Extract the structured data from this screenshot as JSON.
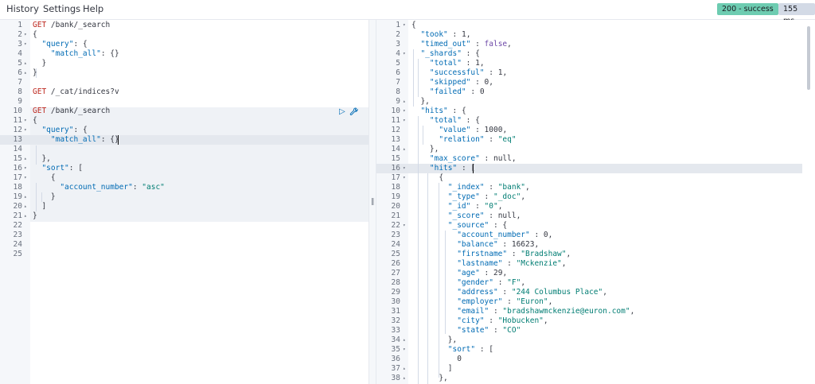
{
  "menu": {
    "history": "History",
    "settings": "Settings",
    "help": "Help"
  },
  "status": {
    "code": "200 - success",
    "time": "155 ms",
    "success_color": "#6dccb1"
  },
  "icons": {
    "play": "play-icon",
    "wrench": "wrench-icon",
    "resize": "resize-handle-icon",
    "fold_down": "fold-down-icon",
    "fold_up": "fold-up-icon"
  },
  "request_editor": {
    "lines": [
      {
        "n": "1",
        "fold": "",
        "t": [
          [
            "method",
            "GET"
          ],
          [
            "url",
            " /bank/_search"
          ]
        ]
      },
      {
        "n": "2",
        "fold": "▾",
        "t": [
          [
            "punc",
            "{"
          ]
        ]
      },
      {
        "n": "3",
        "fold": "▾",
        "t": [
          [
            "punc",
            "  "
          ],
          [
            "key",
            "\"query\""
          ],
          [
            "punc",
            ": {"
          ]
        ]
      },
      {
        "n": "4",
        "fold": "",
        "t": [
          [
            "punc",
            "    "
          ],
          [
            "key",
            "\"match_all\""
          ],
          [
            "punc",
            ": {}"
          ]
        ]
      },
      {
        "n": "5",
        "fold": "▴",
        "t": [
          [
            "punc",
            "  }"
          ]
        ]
      },
      {
        "n": "6",
        "fold": "▴",
        "t": [
          [
            "punc",
            "}"
          ]
        ]
      },
      {
        "n": "7",
        "fold": "",
        "t": []
      },
      {
        "n": "8",
        "fold": "",
        "t": [
          [
            "method",
            "GET"
          ],
          [
            "url",
            " /_cat/indices?v"
          ]
        ]
      },
      {
        "n": "9",
        "fold": "",
        "t": []
      },
      {
        "n": "10",
        "fold": "",
        "t": [
          [
            "method",
            "GET"
          ],
          [
            "url",
            " /bank/_search"
          ]
        ]
      },
      {
        "n": "11",
        "fold": "▾",
        "t": [
          [
            "punc",
            "{"
          ]
        ]
      },
      {
        "n": "12",
        "fold": "▾",
        "t": [
          [
            "punc",
            "  "
          ],
          [
            "key",
            "\"query\""
          ],
          [
            "punc",
            ": {"
          ]
        ]
      },
      {
        "n": "13",
        "fold": "",
        "t": [
          [
            "punc",
            "    "
          ],
          [
            "key",
            "\"match_all\""
          ],
          [
            "punc",
            ": {}"
          ]
        ]
      },
      {
        "n": "14",
        "fold": "",
        "t": []
      },
      {
        "n": "15",
        "fold": "▴",
        "t": [
          [
            "punc",
            "  },"
          ]
        ]
      },
      {
        "n": "16",
        "fold": "▾",
        "t": [
          [
            "punc",
            "  "
          ],
          [
            "key",
            "\"sort\""
          ],
          [
            "punc",
            ": ["
          ]
        ]
      },
      {
        "n": "17",
        "fold": "▾",
        "t": [
          [
            "punc",
            "    {"
          ]
        ]
      },
      {
        "n": "18",
        "fold": "",
        "t": [
          [
            "punc",
            "      "
          ],
          [
            "key",
            "\"account_number\""
          ],
          [
            "punc",
            ": "
          ],
          [
            "str",
            "\"asc\""
          ]
        ]
      },
      {
        "n": "19",
        "fold": "▴",
        "t": [
          [
            "punc",
            "    }"
          ]
        ]
      },
      {
        "n": "20",
        "fold": "▴",
        "t": [
          [
            "punc",
            "  ]"
          ]
        ]
      },
      {
        "n": "21",
        "fold": "▴",
        "t": [
          [
            "punc",
            "}"
          ]
        ]
      },
      {
        "n": "22",
        "fold": "",
        "t": []
      },
      {
        "n": "23",
        "fold": "",
        "t": []
      },
      {
        "n": "24",
        "fold": "",
        "t": []
      },
      {
        "n": "25",
        "fold": "",
        "t": []
      }
    ]
  },
  "response_viewer": {
    "lines": [
      {
        "n": "1",
        "fold": "▾",
        "t": [
          [
            "punc",
            "{"
          ]
        ]
      },
      {
        "n": "2",
        "fold": "",
        "t": [
          [
            "punc",
            "  "
          ],
          [
            "key",
            "\"took\""
          ],
          [
            "punc",
            " : "
          ],
          [
            "num",
            "1"
          ],
          [
            "punc",
            ","
          ]
        ]
      },
      {
        "n": "3",
        "fold": "",
        "t": [
          [
            "punc",
            "  "
          ],
          [
            "key",
            "\"timed_out\""
          ],
          [
            "punc",
            " : "
          ],
          [
            "bool",
            "false"
          ],
          [
            "punc",
            ","
          ]
        ]
      },
      {
        "n": "4",
        "fold": "▾",
        "t": [
          [
            "punc",
            "  "
          ],
          [
            "key",
            "\"_shards\""
          ],
          [
            "punc",
            " : {"
          ]
        ]
      },
      {
        "n": "5",
        "fold": "",
        "t": [
          [
            "punc",
            "    "
          ],
          [
            "key",
            "\"total\""
          ],
          [
            "punc",
            " : "
          ],
          [
            "num",
            "1"
          ],
          [
            "punc",
            ","
          ]
        ]
      },
      {
        "n": "6",
        "fold": "",
        "t": [
          [
            "punc",
            "    "
          ],
          [
            "key",
            "\"successful\""
          ],
          [
            "punc",
            " : "
          ],
          [
            "num",
            "1"
          ],
          [
            "punc",
            ","
          ]
        ]
      },
      {
        "n": "7",
        "fold": "",
        "t": [
          [
            "punc",
            "    "
          ],
          [
            "key",
            "\"skipped\""
          ],
          [
            "punc",
            " : "
          ],
          [
            "num",
            "0"
          ],
          [
            "punc",
            ","
          ]
        ]
      },
      {
        "n": "8",
        "fold": "",
        "t": [
          [
            "punc",
            "    "
          ],
          [
            "key",
            "\"failed\""
          ],
          [
            "punc",
            " : "
          ],
          [
            "num",
            "0"
          ]
        ]
      },
      {
        "n": "9",
        "fold": "▴",
        "t": [
          [
            "punc",
            "  },"
          ]
        ]
      },
      {
        "n": "10",
        "fold": "▾",
        "t": [
          [
            "punc",
            "  "
          ],
          [
            "key",
            "\"hits\""
          ],
          [
            "punc",
            " : {"
          ]
        ]
      },
      {
        "n": "11",
        "fold": "▾",
        "t": [
          [
            "punc",
            "    "
          ],
          [
            "key",
            "\"total\""
          ],
          [
            "punc",
            " : {"
          ]
        ]
      },
      {
        "n": "12",
        "fold": "",
        "t": [
          [
            "punc",
            "      "
          ],
          [
            "key",
            "\"value\""
          ],
          [
            "punc",
            " : "
          ],
          [
            "num",
            "1000"
          ],
          [
            "punc",
            ","
          ]
        ]
      },
      {
        "n": "13",
        "fold": "",
        "t": [
          [
            "punc",
            "      "
          ],
          [
            "key",
            "\"relation\""
          ],
          [
            "punc",
            " : "
          ],
          [
            "str",
            "\"eq\""
          ]
        ]
      },
      {
        "n": "14",
        "fold": "▴",
        "t": [
          [
            "punc",
            "    },"
          ]
        ]
      },
      {
        "n": "15",
        "fold": "",
        "t": [
          [
            "punc",
            "    "
          ],
          [
            "key",
            "\"max_score\""
          ],
          [
            "punc",
            " : "
          ],
          [
            "num",
            "null"
          ],
          [
            "punc",
            ","
          ]
        ]
      },
      {
        "n": "16",
        "fold": "▾",
        "t": [
          [
            "punc",
            "    "
          ],
          [
            "key",
            "\"hits\""
          ],
          [
            "punc",
            " : ["
          ]
        ]
      },
      {
        "n": "17",
        "fold": "▾",
        "t": [
          [
            "punc",
            "      {"
          ]
        ]
      },
      {
        "n": "18",
        "fold": "",
        "t": [
          [
            "punc",
            "        "
          ],
          [
            "key",
            "\"_index\""
          ],
          [
            "punc",
            " : "
          ],
          [
            "str",
            "\"bank\""
          ],
          [
            "punc",
            ","
          ]
        ]
      },
      {
        "n": "19",
        "fold": "",
        "t": [
          [
            "punc",
            "        "
          ],
          [
            "key",
            "\"_type\""
          ],
          [
            "punc",
            " : "
          ],
          [
            "str",
            "\"_doc\""
          ],
          [
            "punc",
            ","
          ]
        ]
      },
      {
        "n": "20",
        "fold": "",
        "t": [
          [
            "punc",
            "        "
          ],
          [
            "key",
            "\"_id\""
          ],
          [
            "punc",
            " : "
          ],
          [
            "str",
            "\"0\""
          ],
          [
            "punc",
            ","
          ]
        ]
      },
      {
        "n": "21",
        "fold": "",
        "t": [
          [
            "punc",
            "        "
          ],
          [
            "key",
            "\"_score\""
          ],
          [
            "punc",
            " : "
          ],
          [
            "num",
            "null"
          ],
          [
            "punc",
            ","
          ]
        ]
      },
      {
        "n": "22",
        "fold": "▾",
        "t": [
          [
            "punc",
            "        "
          ],
          [
            "key",
            "\"_source\""
          ],
          [
            "punc",
            " : {"
          ]
        ]
      },
      {
        "n": "23",
        "fold": "",
        "t": [
          [
            "punc",
            "          "
          ],
          [
            "key",
            "\"account_number\""
          ],
          [
            "punc",
            " : "
          ],
          [
            "num",
            "0"
          ],
          [
            "punc",
            ","
          ]
        ]
      },
      {
        "n": "24",
        "fold": "",
        "t": [
          [
            "punc",
            "          "
          ],
          [
            "key",
            "\"balance\""
          ],
          [
            "punc",
            " : "
          ],
          [
            "num",
            "16623"
          ],
          [
            "punc",
            ","
          ]
        ]
      },
      {
        "n": "25",
        "fold": "",
        "t": [
          [
            "punc",
            "          "
          ],
          [
            "key",
            "\"firstname\""
          ],
          [
            "punc",
            " : "
          ],
          [
            "str",
            "\"Bradshaw\""
          ],
          [
            "punc",
            ","
          ]
        ]
      },
      {
        "n": "26",
        "fold": "",
        "t": [
          [
            "punc",
            "          "
          ],
          [
            "key",
            "\"lastname\""
          ],
          [
            "punc",
            " : "
          ],
          [
            "str",
            "\"Mckenzie\""
          ],
          [
            "punc",
            ","
          ]
        ]
      },
      {
        "n": "27",
        "fold": "",
        "t": [
          [
            "punc",
            "          "
          ],
          [
            "key",
            "\"age\""
          ],
          [
            "punc",
            " : "
          ],
          [
            "num",
            "29"
          ],
          [
            "punc",
            ","
          ]
        ]
      },
      {
        "n": "28",
        "fold": "",
        "t": [
          [
            "punc",
            "          "
          ],
          [
            "key",
            "\"gender\""
          ],
          [
            "punc",
            " : "
          ],
          [
            "str",
            "\"F\""
          ],
          [
            "punc",
            ","
          ]
        ]
      },
      {
        "n": "29",
        "fold": "",
        "t": [
          [
            "punc",
            "          "
          ],
          [
            "key",
            "\"address\""
          ],
          [
            "punc",
            " : "
          ],
          [
            "str",
            "\"244 Columbus Place\""
          ],
          [
            "punc",
            ","
          ]
        ]
      },
      {
        "n": "30",
        "fold": "",
        "t": [
          [
            "punc",
            "          "
          ],
          [
            "key",
            "\"employer\""
          ],
          [
            "punc",
            " : "
          ],
          [
            "str",
            "\"Euron\""
          ],
          [
            "punc",
            ","
          ]
        ]
      },
      {
        "n": "31",
        "fold": "",
        "t": [
          [
            "punc",
            "          "
          ],
          [
            "key",
            "\"email\""
          ],
          [
            "punc",
            " : "
          ],
          [
            "str",
            "\"bradshawmckenzie@euron.com\""
          ],
          [
            "punc",
            ","
          ]
        ]
      },
      {
        "n": "32",
        "fold": "",
        "t": [
          [
            "punc",
            "          "
          ],
          [
            "key",
            "\"city\""
          ],
          [
            "punc",
            " : "
          ],
          [
            "str",
            "\"Hobucken\""
          ],
          [
            "punc",
            ","
          ]
        ]
      },
      {
        "n": "33",
        "fold": "",
        "t": [
          [
            "punc",
            "          "
          ],
          [
            "key",
            "\"state\""
          ],
          [
            "punc",
            " : "
          ],
          [
            "str",
            "\"CO\""
          ]
        ]
      },
      {
        "n": "34",
        "fold": "▴",
        "t": [
          [
            "punc",
            "        },"
          ]
        ]
      },
      {
        "n": "35",
        "fold": "▾",
        "t": [
          [
            "punc",
            "        "
          ],
          [
            "key",
            "\"sort\""
          ],
          [
            "punc",
            " : ["
          ]
        ]
      },
      {
        "n": "36",
        "fold": "",
        "t": [
          [
            "punc",
            "          "
          ],
          [
            "num",
            "0"
          ]
        ]
      },
      {
        "n": "37",
        "fold": "▴",
        "t": [
          [
            "punc",
            "        ]"
          ]
        ]
      },
      {
        "n": "38",
        "fold": "▴",
        "t": [
          [
            "punc",
            "      },"
          ]
        ]
      }
    ]
  }
}
